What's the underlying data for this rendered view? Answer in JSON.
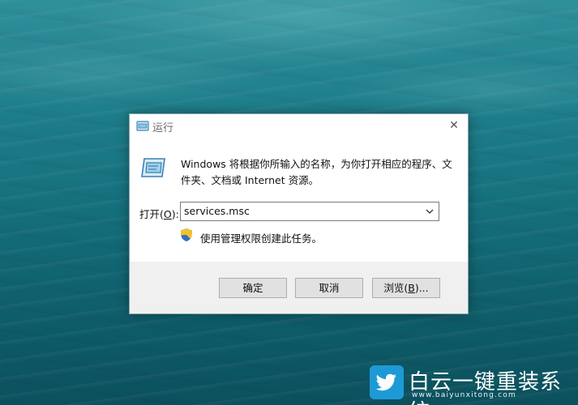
{
  "dialog": {
    "title": "运行",
    "close_label": "✕",
    "description": "Windows 将根据你所输入的名称，为你打开相应的程序、文件夹、文档或 Internet 资源。",
    "open_label_prefix": "打开(",
    "open_label_key": "O",
    "open_label_suffix": "):",
    "input_value": "services.msc",
    "admin_notice": "使用管理权限创建此任务。",
    "buttons": {
      "ok": "确定",
      "cancel": "取消",
      "browse_prefix": "浏览(",
      "browse_key": "B",
      "browse_suffix": ")..."
    }
  },
  "watermark": {
    "title": "白云一键重装系统",
    "url": "www.baiyunxitong.com"
  },
  "icons": {
    "title_icon": "run-icon",
    "big_icon": "run-icon",
    "shield_icon": "uac-shield-icon",
    "dropdown_icon": "chevron-down-icon",
    "logo_icon": "twitter-bird-icon"
  }
}
